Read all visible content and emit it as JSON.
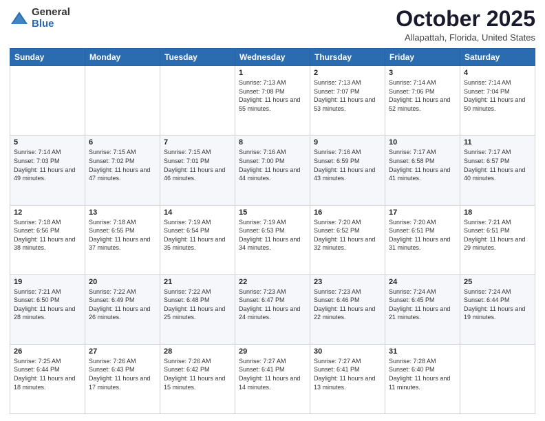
{
  "header": {
    "logo_general": "General",
    "logo_blue": "Blue",
    "month_title": "October 2025",
    "location": "Allapattah, Florida, United States"
  },
  "days_of_week": [
    "Sunday",
    "Monday",
    "Tuesday",
    "Wednesday",
    "Thursday",
    "Friday",
    "Saturday"
  ],
  "weeks": [
    [
      {
        "day": "",
        "info": ""
      },
      {
        "day": "",
        "info": ""
      },
      {
        "day": "",
        "info": ""
      },
      {
        "day": "1",
        "info": "Sunrise: 7:13 AM\nSunset: 7:08 PM\nDaylight: 11 hours and 55 minutes."
      },
      {
        "day": "2",
        "info": "Sunrise: 7:13 AM\nSunset: 7:07 PM\nDaylight: 11 hours and 53 minutes."
      },
      {
        "day": "3",
        "info": "Sunrise: 7:14 AM\nSunset: 7:06 PM\nDaylight: 11 hours and 52 minutes."
      },
      {
        "day": "4",
        "info": "Sunrise: 7:14 AM\nSunset: 7:04 PM\nDaylight: 11 hours and 50 minutes."
      }
    ],
    [
      {
        "day": "5",
        "info": "Sunrise: 7:14 AM\nSunset: 7:03 PM\nDaylight: 11 hours and 49 minutes."
      },
      {
        "day": "6",
        "info": "Sunrise: 7:15 AM\nSunset: 7:02 PM\nDaylight: 11 hours and 47 minutes."
      },
      {
        "day": "7",
        "info": "Sunrise: 7:15 AM\nSunset: 7:01 PM\nDaylight: 11 hours and 46 minutes."
      },
      {
        "day": "8",
        "info": "Sunrise: 7:16 AM\nSunset: 7:00 PM\nDaylight: 11 hours and 44 minutes."
      },
      {
        "day": "9",
        "info": "Sunrise: 7:16 AM\nSunset: 6:59 PM\nDaylight: 11 hours and 43 minutes."
      },
      {
        "day": "10",
        "info": "Sunrise: 7:17 AM\nSunset: 6:58 PM\nDaylight: 11 hours and 41 minutes."
      },
      {
        "day": "11",
        "info": "Sunrise: 7:17 AM\nSunset: 6:57 PM\nDaylight: 11 hours and 40 minutes."
      }
    ],
    [
      {
        "day": "12",
        "info": "Sunrise: 7:18 AM\nSunset: 6:56 PM\nDaylight: 11 hours and 38 minutes."
      },
      {
        "day": "13",
        "info": "Sunrise: 7:18 AM\nSunset: 6:55 PM\nDaylight: 11 hours and 37 minutes."
      },
      {
        "day": "14",
        "info": "Sunrise: 7:19 AM\nSunset: 6:54 PM\nDaylight: 11 hours and 35 minutes."
      },
      {
        "day": "15",
        "info": "Sunrise: 7:19 AM\nSunset: 6:53 PM\nDaylight: 11 hours and 34 minutes."
      },
      {
        "day": "16",
        "info": "Sunrise: 7:20 AM\nSunset: 6:52 PM\nDaylight: 11 hours and 32 minutes."
      },
      {
        "day": "17",
        "info": "Sunrise: 7:20 AM\nSunset: 6:51 PM\nDaylight: 11 hours and 31 minutes."
      },
      {
        "day": "18",
        "info": "Sunrise: 7:21 AM\nSunset: 6:51 PM\nDaylight: 11 hours and 29 minutes."
      }
    ],
    [
      {
        "day": "19",
        "info": "Sunrise: 7:21 AM\nSunset: 6:50 PM\nDaylight: 11 hours and 28 minutes."
      },
      {
        "day": "20",
        "info": "Sunrise: 7:22 AM\nSunset: 6:49 PM\nDaylight: 11 hours and 26 minutes."
      },
      {
        "day": "21",
        "info": "Sunrise: 7:22 AM\nSunset: 6:48 PM\nDaylight: 11 hours and 25 minutes."
      },
      {
        "day": "22",
        "info": "Sunrise: 7:23 AM\nSunset: 6:47 PM\nDaylight: 11 hours and 24 minutes."
      },
      {
        "day": "23",
        "info": "Sunrise: 7:23 AM\nSunset: 6:46 PM\nDaylight: 11 hours and 22 minutes."
      },
      {
        "day": "24",
        "info": "Sunrise: 7:24 AM\nSunset: 6:45 PM\nDaylight: 11 hours and 21 minutes."
      },
      {
        "day": "25",
        "info": "Sunrise: 7:24 AM\nSunset: 6:44 PM\nDaylight: 11 hours and 19 minutes."
      }
    ],
    [
      {
        "day": "26",
        "info": "Sunrise: 7:25 AM\nSunset: 6:44 PM\nDaylight: 11 hours and 18 minutes."
      },
      {
        "day": "27",
        "info": "Sunrise: 7:26 AM\nSunset: 6:43 PM\nDaylight: 11 hours and 17 minutes."
      },
      {
        "day": "28",
        "info": "Sunrise: 7:26 AM\nSunset: 6:42 PM\nDaylight: 11 hours and 15 minutes."
      },
      {
        "day": "29",
        "info": "Sunrise: 7:27 AM\nSunset: 6:41 PM\nDaylight: 11 hours and 14 minutes."
      },
      {
        "day": "30",
        "info": "Sunrise: 7:27 AM\nSunset: 6:41 PM\nDaylight: 11 hours and 13 minutes."
      },
      {
        "day": "31",
        "info": "Sunrise: 7:28 AM\nSunset: 6:40 PM\nDaylight: 11 hours and 11 minutes."
      },
      {
        "day": "",
        "info": ""
      }
    ]
  ]
}
